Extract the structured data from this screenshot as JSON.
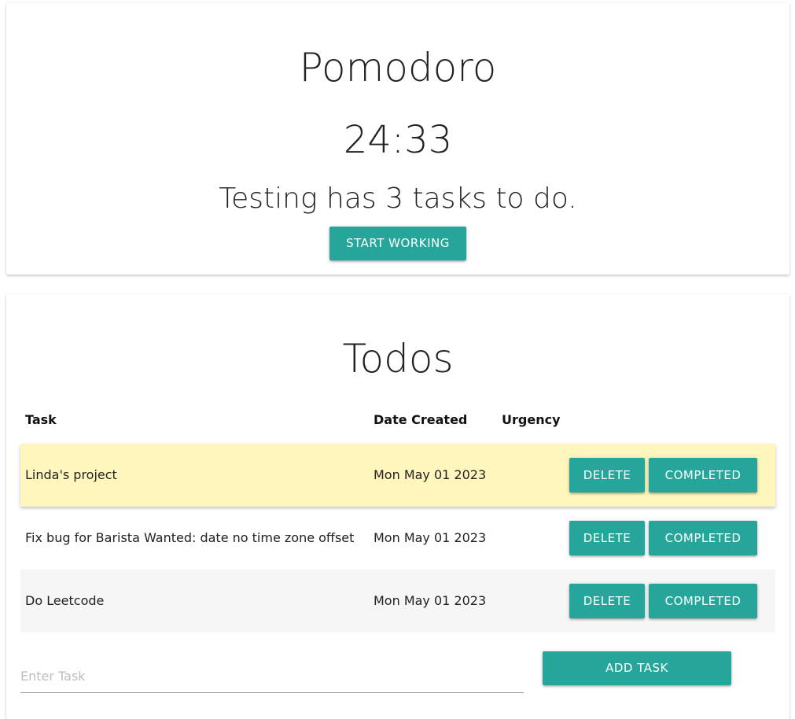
{
  "pomodoro": {
    "title": "Pomodoro",
    "timer": "24:33",
    "status": "Testing has 3 tasks to do.",
    "start_label": "START WORKING"
  },
  "todos": {
    "title": "Todos",
    "columns": {
      "task": "Task",
      "date": "Date Created",
      "urgency": "Urgency"
    },
    "rows": [
      {
        "task": "Linda's project",
        "date": "Mon May 01 2023",
        "delete_label": "DELETE",
        "completed_label": "COMPLETED"
      },
      {
        "task": "Fix bug for Barista Wanted: date no time zone offset",
        "date": "Mon May 01 2023",
        "delete_label": "DELETE",
        "completed_label": "COMPLETED"
      },
      {
        "task": "Do Leetcode",
        "date": "Mon May 01 2023",
        "delete_label": "DELETE",
        "completed_label": "COMPLETED"
      }
    ],
    "input_placeholder": "Enter Task",
    "add_label": "ADD TASK"
  },
  "colors": {
    "accent": "#26a69a",
    "highlight_row": "#fff6bd",
    "striped_row": "#f6f6f6"
  }
}
